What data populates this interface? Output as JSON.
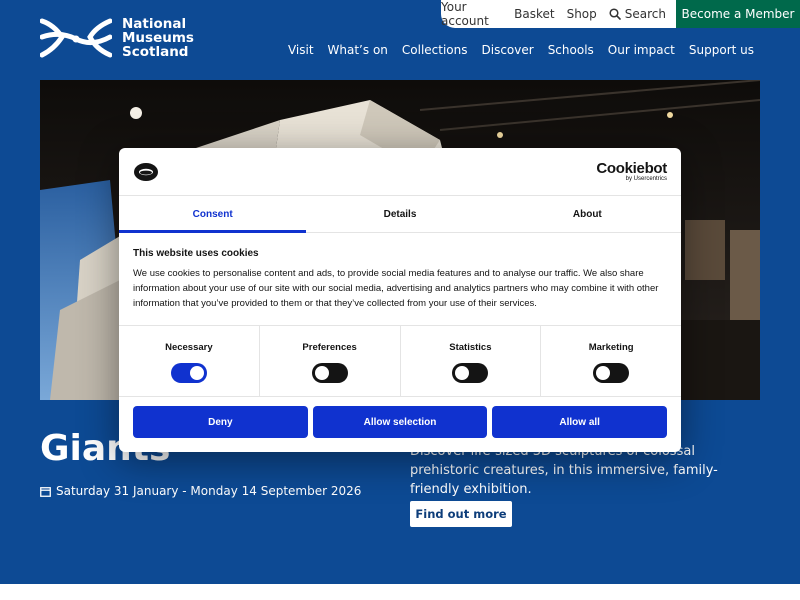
{
  "header": {
    "logo_lines": [
      "National",
      "Museums",
      "Scotland"
    ],
    "utility": [
      "Your account",
      "Basket",
      "Shop",
      "Search"
    ],
    "member_label": "Become a Member",
    "nav": [
      "Visit",
      "What’s on",
      "Collections",
      "Discover",
      "Schools",
      "Our impact",
      "Support us"
    ]
  },
  "hero": {
    "title": "Giants",
    "date": "Saturday 31 January - Monday 14 September 2026",
    "description": "Discover life-sized 3D sculptures of colossal prehistoric creatures, in this immersive, family-friendly exhibition.",
    "cta": "Find out more"
  },
  "dialog": {
    "brand": "Cookiebot",
    "brand_sub": "by Usercentrics",
    "tabs": [
      {
        "label": "Consent",
        "active": true
      },
      {
        "label": "Details",
        "active": false
      },
      {
        "label": "About",
        "active": false
      }
    ],
    "heading": "This website uses cookies",
    "body": "We use cookies to personalise content and ads, to provide social media features and to analyse our traffic. We also share information about your use of our site with our social media, advertising and analytics partners who may combine it with other information that you’ve provided to them or that they’ve collected from your use of their services.",
    "categories": [
      {
        "label": "Necessary",
        "on": true
      },
      {
        "label": "Preferences",
        "on": false
      },
      {
        "label": "Statistics",
        "on": false
      },
      {
        "label": "Marketing",
        "on": false
      }
    ],
    "buttons": {
      "deny": "Deny",
      "selection": "Allow selection",
      "all": "Allow all"
    }
  },
  "colors": {
    "page_blue": "#0d4a94",
    "member_green": "#00694b",
    "consent_blue": "#1032cf"
  }
}
